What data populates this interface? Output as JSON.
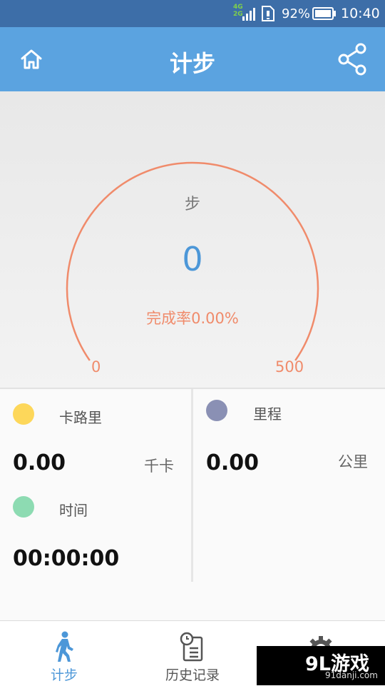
{
  "status_bar": {
    "network_top": "4G",
    "network_bottom": "2G",
    "battery_percent": "92%",
    "time": "10:40",
    "icons": [
      "signal-icon",
      "sim-icon",
      "battery-icon"
    ]
  },
  "header": {
    "title": "计步",
    "home_icon": "home-icon",
    "share_icon": "share-icon",
    "background": "#5ba3e0"
  },
  "gauge": {
    "unit_label": "步",
    "steps_value": "0",
    "completion_text": "完成率0.00%",
    "min_label": "0",
    "max_label": "500",
    "progress_fraction": 0,
    "arc_color": "#f08b6b",
    "value_color": "#4c97d8"
  },
  "stats": {
    "calories": {
      "label": "卡路里",
      "value": "0.00",
      "unit": "千卡",
      "dot_color": "#fdd75a"
    },
    "distance": {
      "label": "里程",
      "value": "0.00",
      "unit": "公里",
      "dot_color": "#8a90b4"
    },
    "time": {
      "label": "时间",
      "value": "00:00:00",
      "dot_color": "#8ddbb2"
    }
  },
  "bottom_nav": {
    "items": [
      {
        "label": "计步",
        "icon": "walking-icon",
        "active": true
      },
      {
        "label": "历史记录",
        "icon": "history-clipboard-icon",
        "active": false
      },
      {
        "label": "",
        "icon": "gear-icon",
        "active": false
      }
    ]
  },
  "watermark": {
    "logo": "9L游戏",
    "site": "91danji.com"
  }
}
